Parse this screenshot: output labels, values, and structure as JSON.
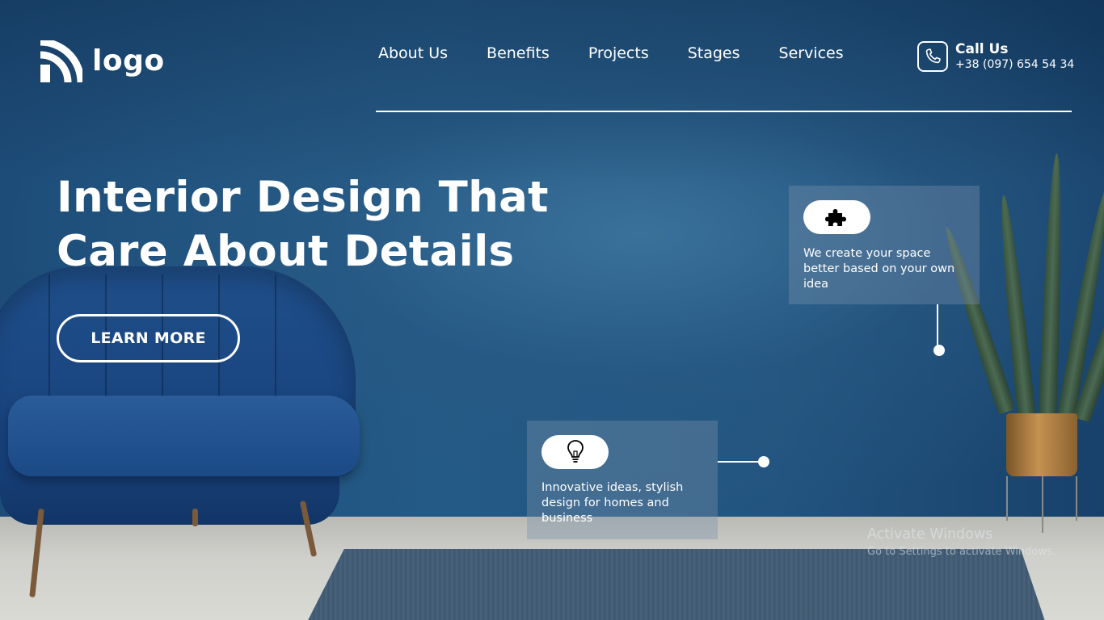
{
  "brand": {
    "logo_text": "logo",
    "logo_icon": "signal-arcs-icon"
  },
  "nav": {
    "items": [
      "About Us",
      "Benefits",
      "Projects",
      "Stages",
      "Services"
    ]
  },
  "contact": {
    "title": "Call Us",
    "phone": "+38 (097) 654 54 34",
    "icon": "phone-icon"
  },
  "hero": {
    "title_line1": "Interior Design That",
    "title_line2": "Care About Details",
    "cta_label": "LEARN MORE"
  },
  "features": [
    {
      "icon": "puzzle-icon",
      "text": "We create your space better based on your own idea"
    },
    {
      "icon": "lightbulb-icon",
      "text": "Innovative ideas, stylish design for homes and business"
    }
  ],
  "system_watermark": {
    "title": "Activate Windows",
    "subtitle": "Go to Settings to activate Windows."
  },
  "colors": {
    "accent": "#ffffff",
    "wall": "#1d4a72",
    "card_overlay": "rgba(120,145,170,0.38)"
  }
}
